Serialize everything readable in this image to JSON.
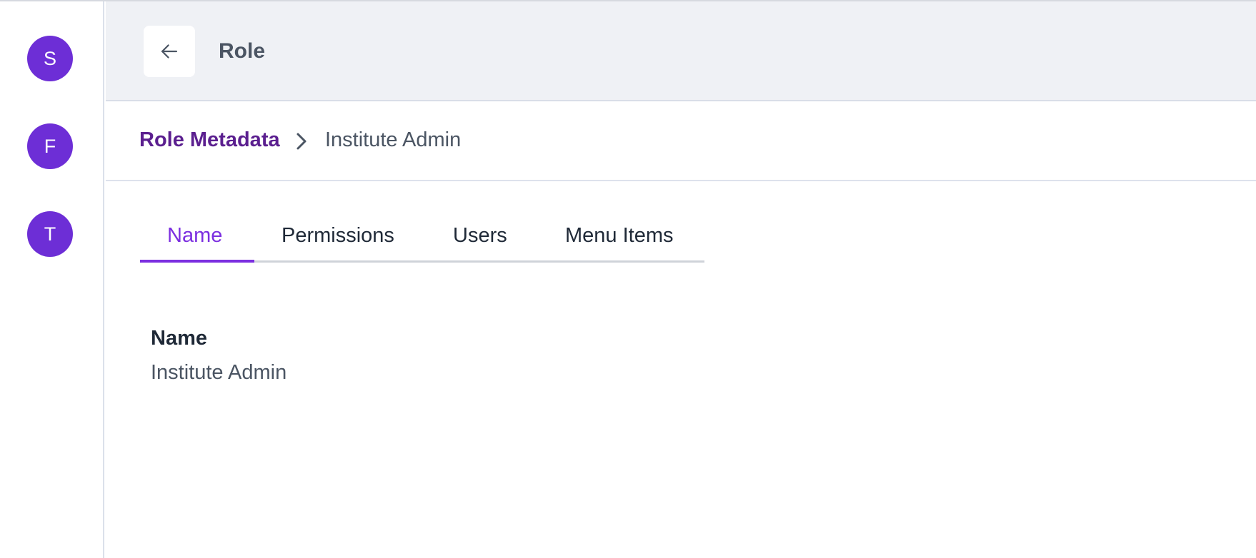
{
  "sidebar": {
    "avatars": [
      "S",
      "F",
      "T"
    ]
  },
  "header": {
    "back_icon": "arrow-left-icon",
    "title": "Role"
  },
  "breadcrumb": {
    "parent": "Role Metadata",
    "separator_icon": "chevron-right-icon",
    "current": "Institute Admin"
  },
  "tabs": [
    {
      "label": "Name",
      "active": true
    },
    {
      "label": "Permissions",
      "active": false
    },
    {
      "label": "Users",
      "active": false
    },
    {
      "label": "Menu Items",
      "active": false
    }
  ],
  "field": {
    "label": "Name",
    "value": "Institute Admin"
  },
  "colors": {
    "accent": "#7c2fe0",
    "avatar": "#6d2ed6",
    "breadcrumb_link": "#5b1f8f",
    "header_bg": "#eff1f5"
  }
}
